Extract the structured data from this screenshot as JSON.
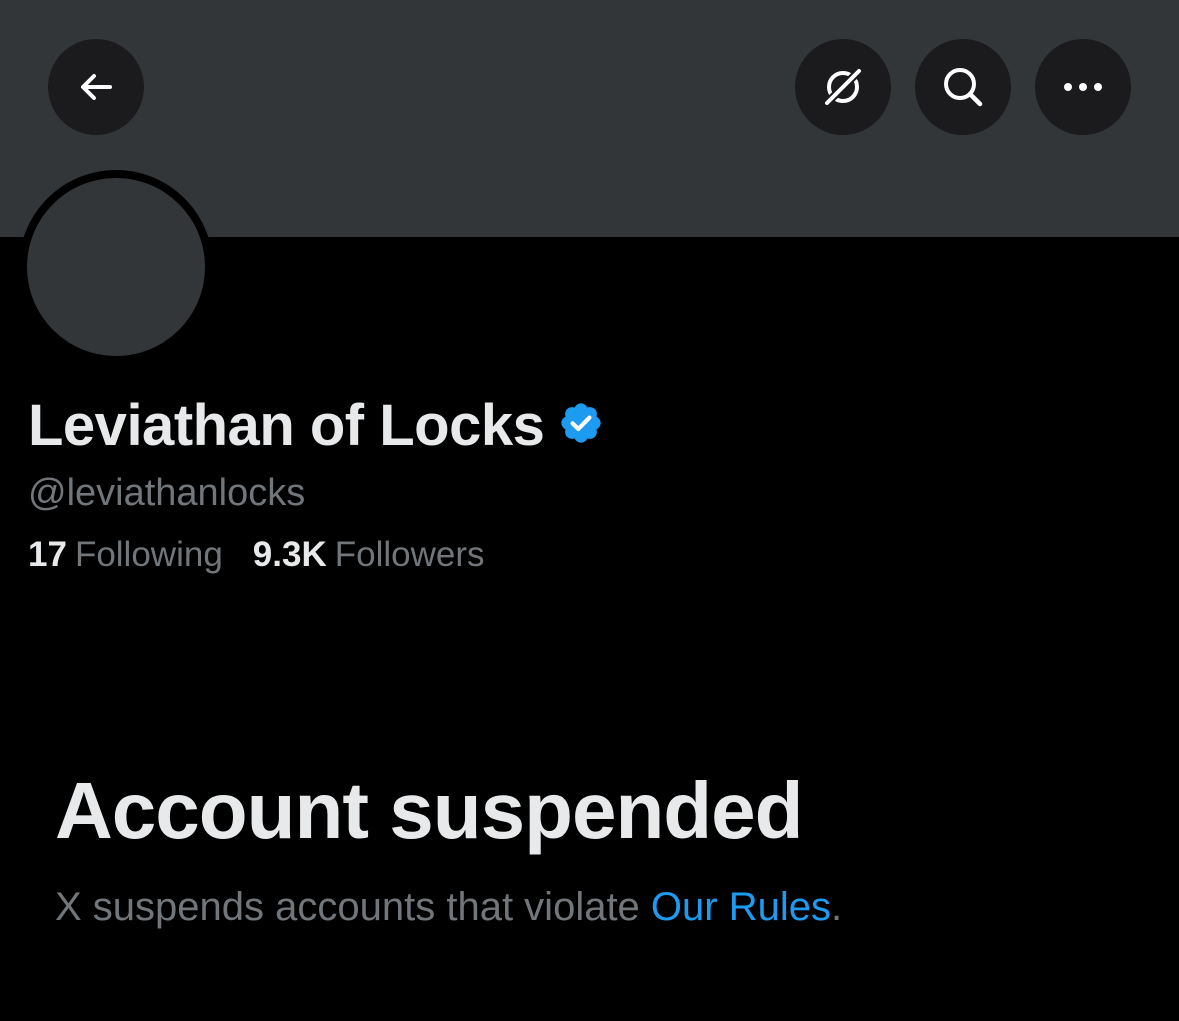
{
  "profile": {
    "display_name": "Leviathan of Locks",
    "handle": "@leviathanlocks",
    "following_count": "17",
    "following_label": "Following",
    "followers_count": "9.3K",
    "followers_label": "Followers",
    "verified": true
  },
  "toolbar": {
    "back_icon": "arrow-left-icon",
    "grok_icon": "grok-icon",
    "search_icon": "search-icon",
    "more_icon": "more-horizontal-icon"
  },
  "suspension": {
    "title": "Account suspended",
    "text_prefix": "X suspends accounts that violate ",
    "link_label": "Our Rules",
    "text_suffix": "."
  },
  "colors": {
    "background": "#000000",
    "banner": "#333639",
    "button_bg": "#1b1b1d",
    "primary_text": "#e7e9ea",
    "secondary_text": "#71767b",
    "accent": "#1d9bf0"
  }
}
